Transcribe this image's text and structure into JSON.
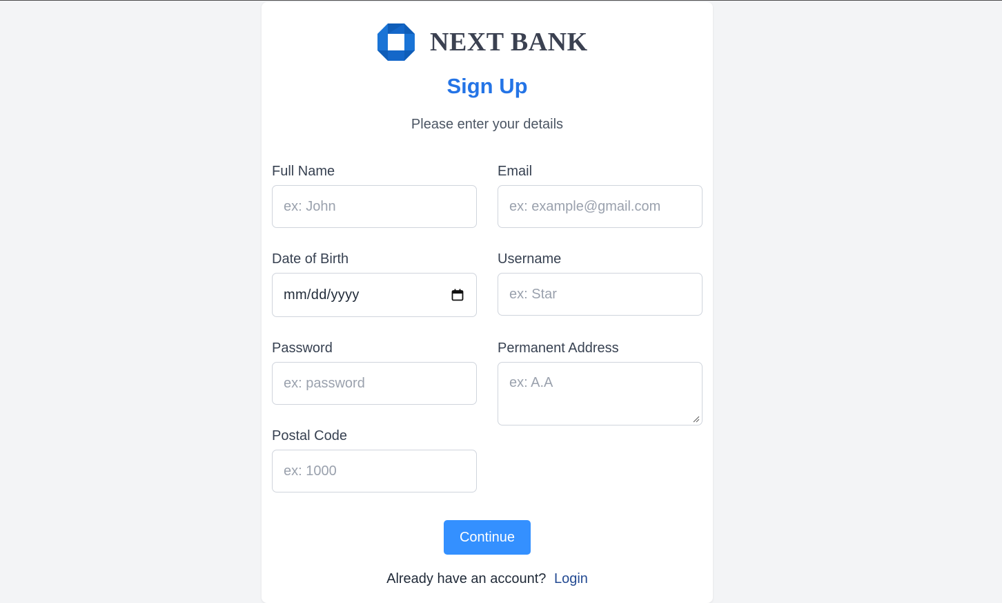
{
  "brand": {
    "name": "NEXT BANK",
    "logo_icon": "octagon-logo-icon",
    "logo_color": "#1467c9"
  },
  "form": {
    "title": "Sign Up",
    "subtitle": "Please enter your details",
    "fields": {
      "full_name": {
        "label": "Full Name",
        "placeholder": "ex: John",
        "value": ""
      },
      "email": {
        "label": "Email",
        "placeholder": "ex: example@gmail.com",
        "value": ""
      },
      "dob": {
        "label": "Date of Birth",
        "value": "mm/dd/yyyy",
        "icon": "calendar-icon"
      },
      "username": {
        "label": "Username",
        "placeholder": "ex: Star",
        "value": ""
      },
      "password": {
        "label": "Password",
        "placeholder": "ex: password",
        "value": ""
      },
      "address": {
        "label": "Permanent Address",
        "placeholder": "ex: A.A",
        "value": ""
      },
      "postal_code": {
        "label": "Postal Code",
        "placeholder": "ex: 1000",
        "value": ""
      }
    },
    "continue_label": "Continue"
  },
  "footer": {
    "prompt": "Already have an account?",
    "login_label": "Login"
  },
  "colors": {
    "accent": "#2474e6",
    "button": "#3490ff",
    "link": "#234a92",
    "background": "#f3f4f6"
  }
}
